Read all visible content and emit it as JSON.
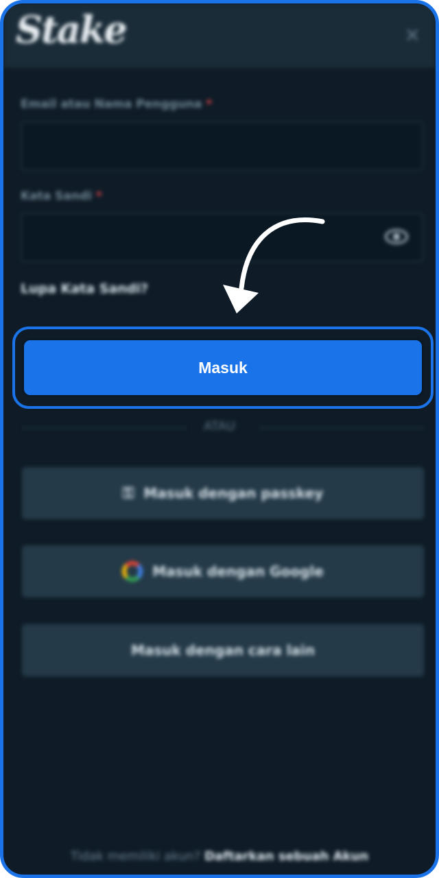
{
  "header": {
    "logo_text": "Stake",
    "close_icon": "close-icon"
  },
  "form": {
    "email_label": "Email atau Nama Pengguna",
    "required_mark": "*",
    "email_value": "",
    "password_label": "Kata Sandi",
    "password_value": "",
    "eye_icon": "eye-icon",
    "forgot_link": "Lupa Kata Sandi?",
    "submit_label": "Masuk"
  },
  "divider": {
    "text": "ATAU"
  },
  "alternatives": {
    "passkey_label": "Masuk dengan passkey",
    "passkey_icon": "passkey-icon",
    "google_label": "Masuk dengan Google",
    "google_icon": "google-icon",
    "other_label": "Masuk dengan cara lain"
  },
  "footer": {
    "prompt": "Tidak memiliki akun?",
    "register_link": "Daftarkan sebuah Akun"
  },
  "theme": {
    "accent": "#1a73e8",
    "background": "#0f1c27",
    "header_bg": "#1a2c38",
    "button_secondary": "#243a48",
    "required_color": "#e5454c"
  }
}
